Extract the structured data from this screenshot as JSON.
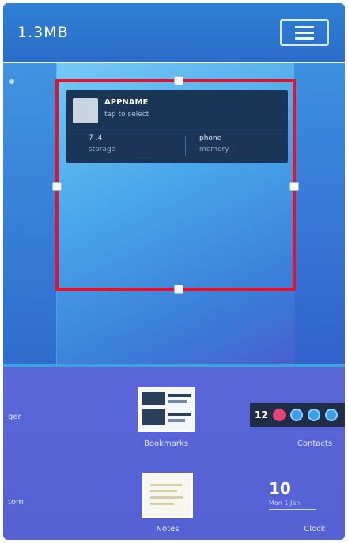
{
  "header": {
    "title": "1.3MB",
    "menu_icon": "menu-icon"
  },
  "widget": {
    "title": "APPNAME",
    "subtitle": "tap to select",
    "stat1_value": "7 .4",
    "stat1_label": "storage",
    "stat2_value": "phone",
    "stat2_label": "memory"
  },
  "tray": {
    "left_partial_1": "ger",
    "left_partial_2": "tom",
    "item1_label": "Bookmarks",
    "item2_label": "Contacts",
    "item3_label": "Notes",
    "item4_label": "Clock",
    "badge_number": "12",
    "clock_time": "10",
    "clock_date": "Mon 1 Jan"
  },
  "colors": {
    "selection_border": "#e0142e",
    "tray_background": "#5a67d8",
    "header_background": "#2c6dc9"
  }
}
